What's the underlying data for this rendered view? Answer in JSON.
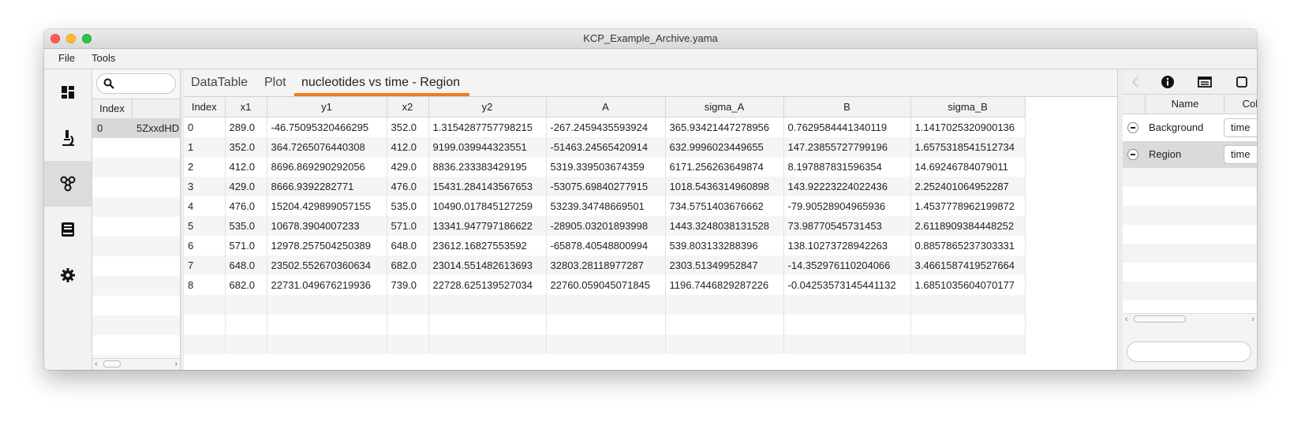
{
  "window": {
    "title": "KCP_Example_Archive.yama"
  },
  "menu": {
    "file": "File",
    "tools": "Tools"
  },
  "sidebar": {
    "items": [
      {
        "name": "dashboard-icon"
      },
      {
        "name": "microscope-icon"
      },
      {
        "name": "network-icon"
      },
      {
        "name": "book-icon"
      },
      {
        "name": "gear-icon"
      }
    ]
  },
  "list_panel": {
    "search": {
      "placeholder": ""
    },
    "header": {
      "index": "Index",
      "col2": ""
    },
    "rows": [
      {
        "index": "0",
        "name": "5ZxxdHD"
      }
    ]
  },
  "tabs": [
    {
      "label": "DataTable"
    },
    {
      "label": "Plot"
    },
    {
      "label": "nucleotides vs time - Region"
    }
  ],
  "table": {
    "columns": [
      "Index",
      "x1",
      "y1",
      "x2",
      "y2",
      "A",
      "sigma_A",
      "B",
      "sigma_B"
    ],
    "rows": [
      [
        "0",
        "289.0",
        "-46.75095320466295",
        "352.0",
        "1.3154287757798215",
        "-267.2459435593924",
        "365.93421447278956",
        "0.7629584441340119",
        "1.1417025320900136"
      ],
      [
        "1",
        "352.0",
        "364.7265076440308",
        "412.0",
        "9199.039944323551",
        "-51463.24565420914",
        "632.9996023449655",
        "147.23855727799196",
        "1.6575318541512734"
      ],
      [
        "2",
        "412.0",
        "8696.869290292056",
        "429.0",
        "8836.233383429195",
        "5319.339503674359",
        "6171.256263649874",
        "8.197887831596354",
        "14.69246784079011"
      ],
      [
        "3",
        "429.0",
        "8666.9392282771",
        "476.0",
        "15431.284143567653",
        "-53075.69840277915",
        "1018.5436314960898",
        "143.92223224022436",
        "2.252401064952287"
      ],
      [
        "4",
        "476.0",
        "15204.429899057155",
        "535.0",
        "10490.017845127259",
        "53239.34748669501",
        "734.5751403676662",
        "-79.90528904965936",
        "1.4537778962199872"
      ],
      [
        "5",
        "535.0",
        "10678.3904007233",
        "571.0",
        "13341.947797186622",
        "-28905.03201893998",
        "1443.3248038131528",
        "73.98770545731453",
        "2.6118909384448252"
      ],
      [
        "6",
        "571.0",
        "12978.257504250389",
        "648.0",
        "23612.16827553592",
        "-65878.40548800994",
        "539.803133288396",
        "138.10273728942263",
        "0.8857865237303331"
      ],
      [
        "7",
        "648.0",
        "23502.552670360634",
        "682.0",
        "23014.551482613693",
        "32803.28118977287",
        "2303.51349952847",
        "-14.352976110204066",
        "3.4661587419527664"
      ],
      [
        "8",
        "682.0",
        "22731.049676219936",
        "739.0",
        "22728.625139527034",
        "22760.059045071845",
        "1196.7446829287226",
        "-0.04253573145441132",
        "1.6851035604070177"
      ]
    ]
  },
  "right_panel": {
    "header": {
      "name": "Name",
      "column": "Column"
    },
    "rows": [
      {
        "name": "Background",
        "column": "time"
      },
      {
        "name": "Region",
        "column": "time"
      }
    ],
    "bottom_input": {
      "placeholder": ""
    }
  }
}
